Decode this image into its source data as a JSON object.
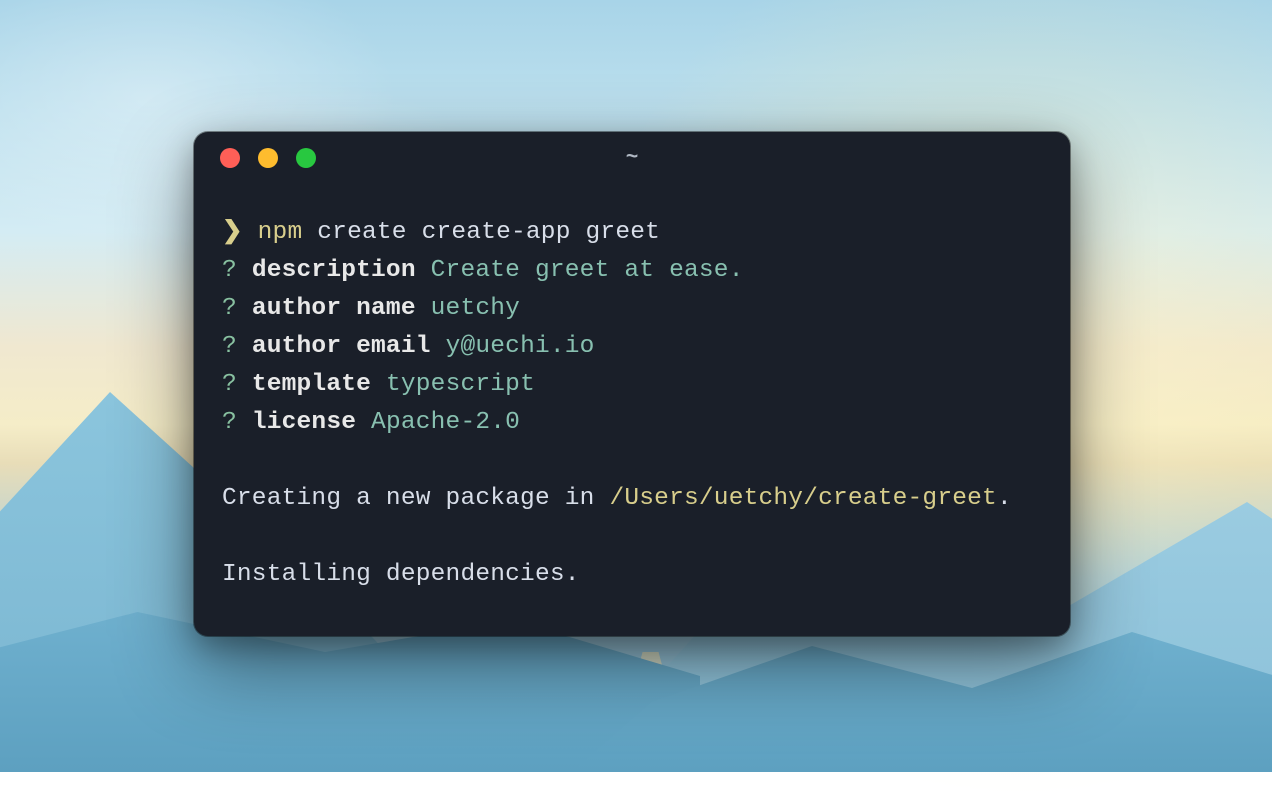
{
  "window": {
    "title": "~"
  },
  "command": {
    "prompt_symbol": "❯",
    "bin": "npm",
    "args": "create create-app greet"
  },
  "prompts": [
    {
      "marker": "?",
      "label": "description",
      "answer": "Create greet at ease."
    },
    {
      "marker": "?",
      "label": "author name",
      "answer": "uetchy"
    },
    {
      "marker": "?",
      "label": "author email",
      "answer": "y@uechi.io"
    },
    {
      "marker": "?",
      "label": "template",
      "answer": "typescript"
    },
    {
      "marker": "?",
      "label": "license",
      "answer": "Apache-2.0"
    }
  ],
  "status": {
    "creating_prefix": "Creating a new package in ",
    "creating_path": "/Users/uetchy/create-greet",
    "creating_suffix": ".",
    "installing": "Installing dependencies."
  }
}
